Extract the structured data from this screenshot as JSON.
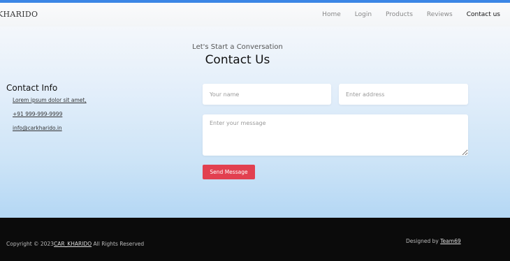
{
  "brand": "KHARIDO",
  "nav": {
    "items": [
      {
        "label": "Home"
      },
      {
        "label": "Login"
      },
      {
        "label": "Products"
      },
      {
        "label": "Reviews"
      },
      {
        "label": "Contact us",
        "active": true
      }
    ]
  },
  "hero": {
    "eyebrow": "Let's Start a Conversation",
    "heading": "Contact Us"
  },
  "contact_info": {
    "title": "Contact Info",
    "address": "Lorem ipsum dolor sit amet,",
    "phone": "+91 999-999-9999",
    "email": "info@carkharido.in"
  },
  "form": {
    "name_placeholder": "Your name",
    "address_placeholder": "Enter address",
    "message_placeholder": "Enter your message",
    "submit_label": "Send Message"
  },
  "footer": {
    "copyright_prefix": "Copyright © 2023",
    "copyright_link": "CAR_KHARIDO",
    "copyright_suffix": " All Rights Reserved",
    "designed_prefix": "Designed by ",
    "designed_link": "Team69"
  },
  "colors": {
    "accent_bar": "#3b86e6",
    "send_button": "#e24050",
    "footer_bg": "#0b0b0b"
  }
}
